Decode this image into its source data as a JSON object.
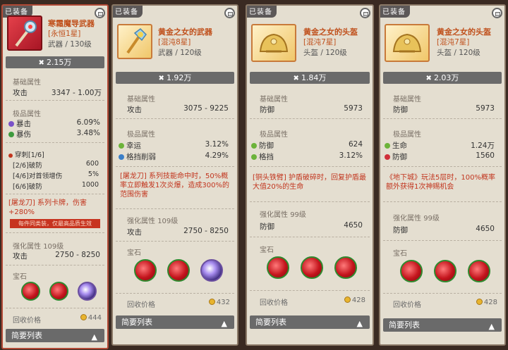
{
  "cards": [
    {
      "tag": "已装备",
      "name": "寒霜魔导武器",
      "star": "[永恒1星]",
      "type": "武器 / 130级",
      "power": "2.15万",
      "base_label": "基础属性",
      "base_rows": [
        {
          "name": "攻击",
          "value": "3347 - 1.00万"
        }
      ],
      "extreme_label": "极品属性",
      "extreme_rows": [
        {
          "name": "暴击",
          "value": "6.09%",
          "dot": "#7a52c8"
        },
        {
          "name": "暴伤",
          "value": "3.48%",
          "dot": "#3e9a3e"
        }
      ],
      "pierce_title": "穿刺[1/6]",
      "pierce_rows": [
        {
          "name": "[2/6]破防",
          "value": "600"
        },
        {
          "name": "[4/6]对首领增伤",
          "value": "5%"
        },
        {
          "name": "[6/6]破防",
          "value": "1000"
        }
      ],
      "skill": "[屠龙刀] 系列卡牌，伤害+280%",
      "warning": "每件同类装，仅最高品质生效",
      "enhance_label": "强化属性",
      "enhance_level": "109级",
      "enhance_rows": [
        {
          "name": "攻击",
          "value": "2750 - 8250"
        }
      ],
      "gem_label": "宝石",
      "price_label": "回收价格",
      "price": "444",
      "footer": "简要列表"
    },
    {
      "tag": "已装备",
      "name": "黄金之女的武器",
      "star": "[混沌8星]",
      "type": "武器 / 120级",
      "power": "1.92万",
      "base_label": "基础属性",
      "base_rows": [
        {
          "name": "攻击",
          "value": "3075 - 9225"
        }
      ],
      "extreme_label": "极品属性",
      "extreme_rows": [
        {
          "name": "幸运",
          "value": "3.12%",
          "dot": "#6cb33a"
        },
        {
          "name": "格挡削弱",
          "value": "4.29%",
          "dot": "#3b7fc8"
        }
      ],
      "skill": "[屠龙刀] 系列技能命中时，50%概率立即触发1次炎爆，造成300%的范围伤害",
      "enhance_label": "强化属性",
      "enhance_level": "109级",
      "enhance_rows": [
        {
          "name": "攻击",
          "value": "2750 - 8250"
        }
      ],
      "gem_label": "宝石",
      "price_label": "回收价格",
      "price": "432",
      "footer": "简要列表"
    },
    {
      "tag": "已装备",
      "name": "黄金之女的头盔",
      "star": "[混沌7星]",
      "type": "头盔 / 120级",
      "power": "1.84万",
      "base_label": "基础属性",
      "base_rows": [
        {
          "name": "防御",
          "value": "5973"
        }
      ],
      "extreme_label": "极品属性",
      "extreme_rows": [
        {
          "name": "防御",
          "value": "624",
          "dot": "#6cb33a"
        },
        {
          "name": "格挡",
          "value": "3.12%",
          "dot": "#6cb33a"
        }
      ],
      "skill": "[铜头铁臂] 护盾破碎时，回复护盾最大值20%的生命",
      "enhance_label": "强化属性",
      "enhance_level": "99级",
      "enhance_rows": [
        {
          "name": "防御",
          "value": "4650"
        }
      ],
      "gem_label": "宝石",
      "price_label": "回收价格",
      "price": "428",
      "footer": "简要列表"
    },
    {
      "tag": "已装备",
      "name": "黄金之女的头盔",
      "star": "[混沌7星]",
      "type": "头盔 / 120级",
      "power": "2.03万",
      "base_label": "基础属性",
      "base_rows": [
        {
          "name": "防御",
          "value": "5973"
        }
      ],
      "extreme_label": "极品属性",
      "extreme_rows": [
        {
          "name": "生命",
          "value": "1.24万",
          "dot": "#6cb33a"
        },
        {
          "name": "防御",
          "value": "1560",
          "dot": "#d0303a"
        }
      ],
      "skill": "《地下城》玩法5层时，100%概率额外获得1次神赐机会",
      "enhance_label": "强化属性",
      "enhance_level": "99级",
      "enhance_rows": [
        {
          "name": "防御",
          "value": "4650"
        }
      ],
      "gem_label": "宝石",
      "price_label": "回收价格",
      "price": "428",
      "footer": "简要列表"
    }
  ],
  "icons": {
    "weapon1": "frost-staff-icon",
    "weapon2": "gold-scepter-icon",
    "helmet": "gold-helmet-icon",
    "gem": "red-gem-icon",
    "gem_special": "purple-gem-icon",
    "power": "crossed-swords-icon",
    "lock": "lock-icon",
    "coin": "coin-icon",
    "chevron": "chevron-up-icon"
  },
  "colors": {
    "quality": "#c0501c",
    "skill_text": "#c2351e",
    "panel": "#e4ded0",
    "bar": "#6a6a6a"
  }
}
